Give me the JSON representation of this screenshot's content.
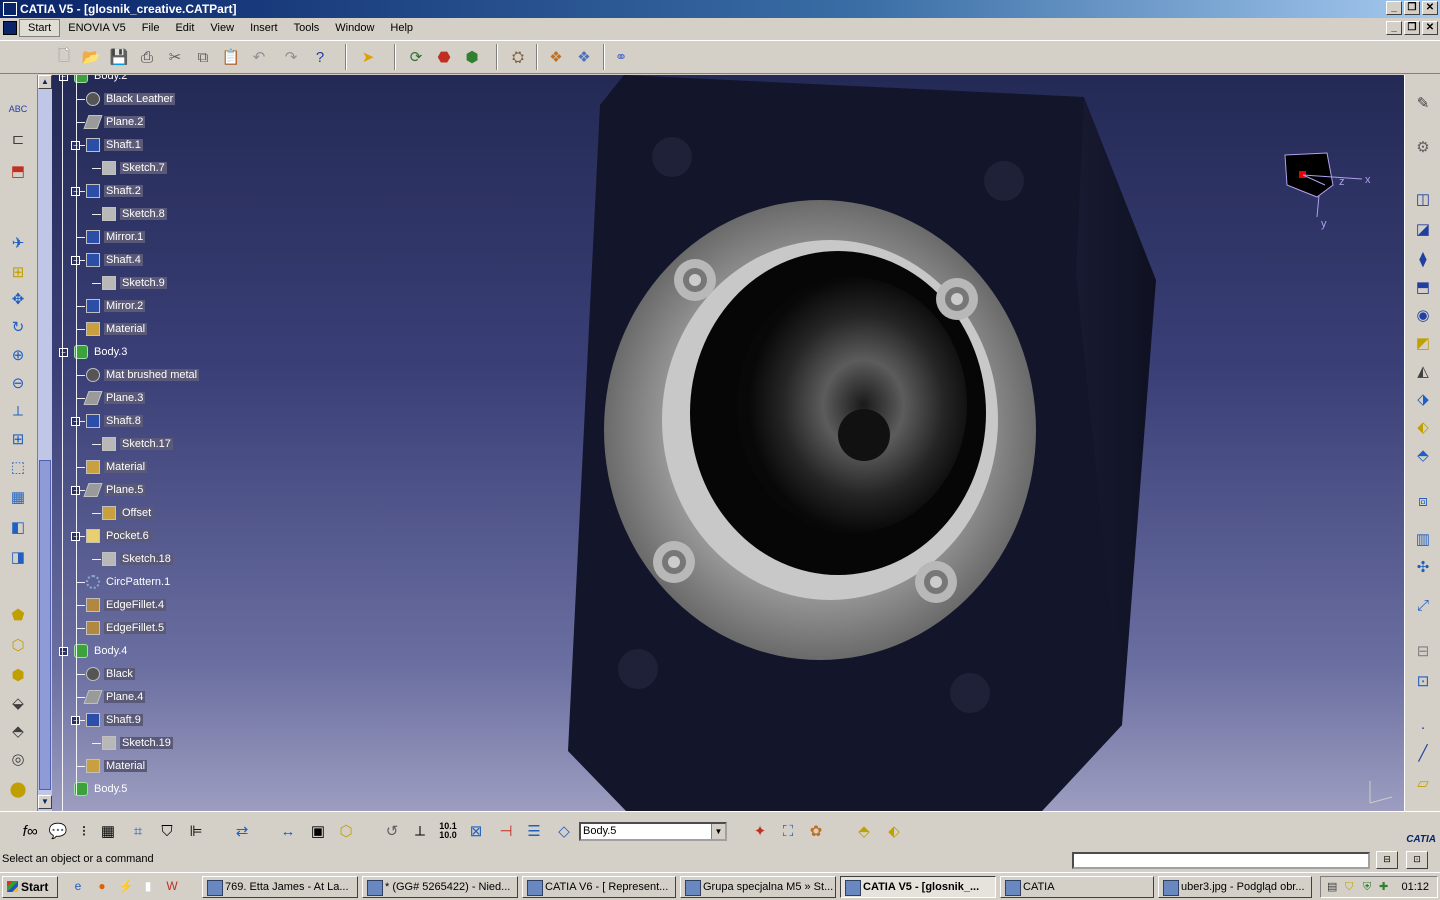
{
  "window": {
    "title": "CATIA V5 - [glosnik_creative.CATPart]",
    "minimize": "_",
    "restore": "❐",
    "close": "✕"
  },
  "menu": [
    "Start",
    "ENOVIA V5",
    "File",
    "Edit",
    "View",
    "Insert",
    "Tools",
    "Window",
    "Help"
  ],
  "tree": [
    {
      "label": "Body.2",
      "type": "body",
      "level": 0
    },
    {
      "label": "Black Leather",
      "type": "mat",
      "level": 1
    },
    {
      "label": "Plane.2",
      "type": "plane",
      "level": 1
    },
    {
      "label": "Shaft.1",
      "type": "shaft",
      "level": 1
    },
    {
      "label": "Sketch.7",
      "type": "sketch",
      "level": 2
    },
    {
      "label": "Shaft.2",
      "type": "shaft",
      "level": 1
    },
    {
      "label": "Sketch.8",
      "type": "sketch",
      "level": 2
    },
    {
      "label": "Mirror.1",
      "type": "shaft",
      "level": 1
    },
    {
      "label": "Shaft.4",
      "type": "shaft",
      "level": 1
    },
    {
      "label": "Sketch.9",
      "type": "sketch",
      "level": 2
    },
    {
      "label": "Mirror.2",
      "type": "shaft",
      "level": 1
    },
    {
      "label": "Material",
      "type": "matfolder",
      "level": 1
    },
    {
      "label": "Body.3",
      "type": "body",
      "level": 0
    },
    {
      "label": "Mat brushed metal",
      "type": "mat",
      "level": 1
    },
    {
      "label": "Plane.3",
      "type": "plane",
      "level": 1
    },
    {
      "label": "Shaft.8",
      "type": "shaft",
      "level": 1
    },
    {
      "label": "Sketch.17",
      "type": "sketch",
      "level": 2
    },
    {
      "label": "Material",
      "type": "matfolder",
      "level": 1
    },
    {
      "label": "Plane.5",
      "type": "plane",
      "level": 1
    },
    {
      "label": "Offset",
      "type": "matfolder",
      "level": 2
    },
    {
      "label": "Pocket.6",
      "type": "pocket",
      "level": 1
    },
    {
      "label": "Sketch.18",
      "type": "sketch",
      "level": 2
    },
    {
      "label": "CircPattern.1",
      "type": "pattern",
      "level": 1
    },
    {
      "label": "EdgeFillet.4",
      "type": "fillet",
      "level": 1
    },
    {
      "label": "EdgeFillet.5",
      "type": "fillet",
      "level": 1
    },
    {
      "label": "Body.4",
      "type": "body",
      "level": 0
    },
    {
      "label": "Black",
      "type": "mat",
      "level": 1
    },
    {
      "label": "Plane.4",
      "type": "plane",
      "level": 1
    },
    {
      "label": "Shaft.9",
      "type": "shaft",
      "level": 1
    },
    {
      "label": "Sketch.19",
      "type": "sketch",
      "level": 2
    },
    {
      "label": "Material",
      "type": "matfolder",
      "level": 1
    },
    {
      "label": "Body.5",
      "type": "body",
      "level": 0
    }
  ],
  "compass": {
    "x": "x",
    "y": "y",
    "z": "z"
  },
  "toolbar": {
    "active_body": "Body.5"
  },
  "status": {
    "message": "Select an object or a command"
  },
  "taskbar": {
    "start": "Start",
    "tasks": [
      {
        "label": "769. Etta James - At La...",
        "active": false
      },
      {
        "label": "* (GG# 5265422) - Nied...",
        "active": false
      },
      {
        "label": "CATIA V6 - [ Represent...",
        "active": false
      },
      {
        "label": "Grupa specjalna M5 » St...",
        "active": false
      },
      {
        "label": "CATIA V5 - [glosnik_...",
        "active": true
      },
      {
        "label": "CATIA",
        "active": false
      },
      {
        "label": "uber3.jpg - Podgląd obr...",
        "active": false
      }
    ],
    "clock": "01:12"
  },
  "colors": {
    "titlebar": "#0a246a",
    "viewport_top": "#242a55",
    "viewport_bottom": "#9c9dc0",
    "speaker_body": "#15172b",
    "ring": "#8a8a8a"
  }
}
